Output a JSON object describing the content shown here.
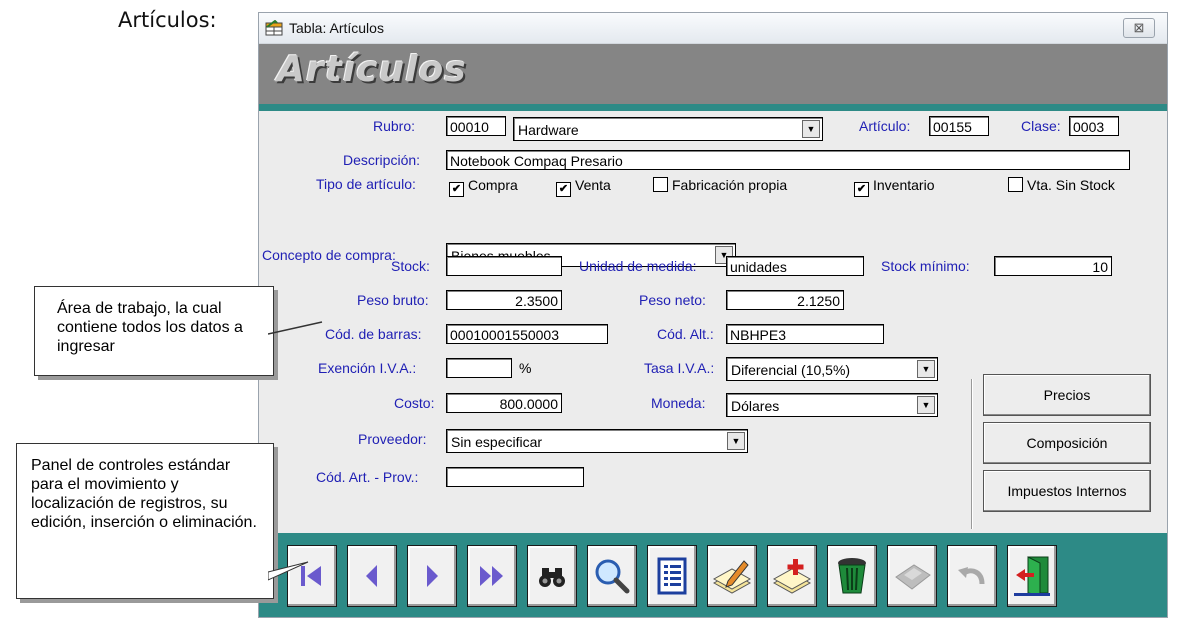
{
  "page": {
    "heading": "Artículos:"
  },
  "window": {
    "title": "Tabla: Artículos",
    "close_glyph": "⊠",
    "banner_title": "Artículos"
  },
  "form": {
    "rubro": {
      "label": "Rubro:",
      "code": "00010",
      "value": "Hardware"
    },
    "articulo": {
      "label": "Artículo:",
      "value": "00155"
    },
    "clase": {
      "label": "Clase:",
      "value": "0003"
    },
    "descripcion": {
      "label": "Descripción:",
      "value": "Notebook Compaq Presario"
    },
    "tipo": {
      "label": "Tipo de artículo:",
      "options": [
        {
          "label": "Compra",
          "checked": true
        },
        {
          "label": "Venta",
          "checked": true
        },
        {
          "label": "Fabricación propia",
          "checked": false
        },
        {
          "label": "Inventario",
          "checked": true
        },
        {
          "label": "Vta. Sin Stock",
          "checked": false
        }
      ]
    },
    "concepto": {
      "label": "Concepto de compra:",
      "value": "Bienes muebles"
    },
    "stock": {
      "label": "Stock:",
      "value": ""
    },
    "unidad": {
      "label": "Unidad de medida:",
      "value": "unidades"
    },
    "stock_minimo": {
      "label": "Stock mínimo:",
      "value": "10"
    },
    "peso_bruto": {
      "label": "Peso bruto:",
      "value": "2.3500"
    },
    "peso_neto": {
      "label": "Peso neto:",
      "value": "2.1250"
    },
    "cod_barras": {
      "label": "Cód. de barras:",
      "value": "00010001550003"
    },
    "cod_alt": {
      "label": "Cód. Alt.:",
      "value": "NBHPE3"
    },
    "exencion": {
      "label": "Exención I.V.A.:",
      "value": "",
      "unit": "%"
    },
    "tasa": {
      "label": "Tasa I.V.A.:",
      "value": "Diferencial (10,5%)"
    },
    "costo": {
      "label": "Costo:",
      "value": "800.0000"
    },
    "moneda": {
      "label": "Moneda:",
      "value": "Dólares"
    },
    "proveedor": {
      "label": "Proveedor:",
      "value": "Sin especificar"
    },
    "cod_art_prov": {
      "label": "Cód. Art. - Prov.:",
      "value": ""
    }
  },
  "buttons": {
    "precios": "Precios",
    "composicion": "Composición",
    "impuestos": "Impuestos Internos"
  },
  "toolbar": {
    "buttons": [
      {
        "name": "first-record",
        "icon": "first-icon"
      },
      {
        "name": "previous-record",
        "icon": "previous-icon"
      },
      {
        "name": "next-record",
        "icon": "next-icon"
      },
      {
        "name": "last-record",
        "icon": "last-icon"
      },
      {
        "name": "find",
        "icon": "binoculars-icon"
      },
      {
        "name": "search",
        "icon": "magnifier-icon"
      },
      {
        "name": "list",
        "icon": "list-icon"
      },
      {
        "name": "edit",
        "icon": "edit-icon"
      },
      {
        "name": "insert",
        "icon": "insert-icon"
      },
      {
        "name": "delete",
        "icon": "trash-icon"
      },
      {
        "name": "save",
        "icon": "save-icon"
      },
      {
        "name": "undo",
        "icon": "undo-icon"
      },
      {
        "name": "exit",
        "icon": "exit-icon"
      }
    ]
  },
  "callouts": {
    "work_area": "Área de trabajo, la cual contiene todos los datos a ingresar",
    "controls_panel": "Panel de controles estándar para el movimiento y localización de registros, su edición, inserción o eliminación."
  },
  "colors": {
    "label_blue": "#1f1fb4",
    "teal": "#2d8a86",
    "banner_gray": "#858585"
  }
}
